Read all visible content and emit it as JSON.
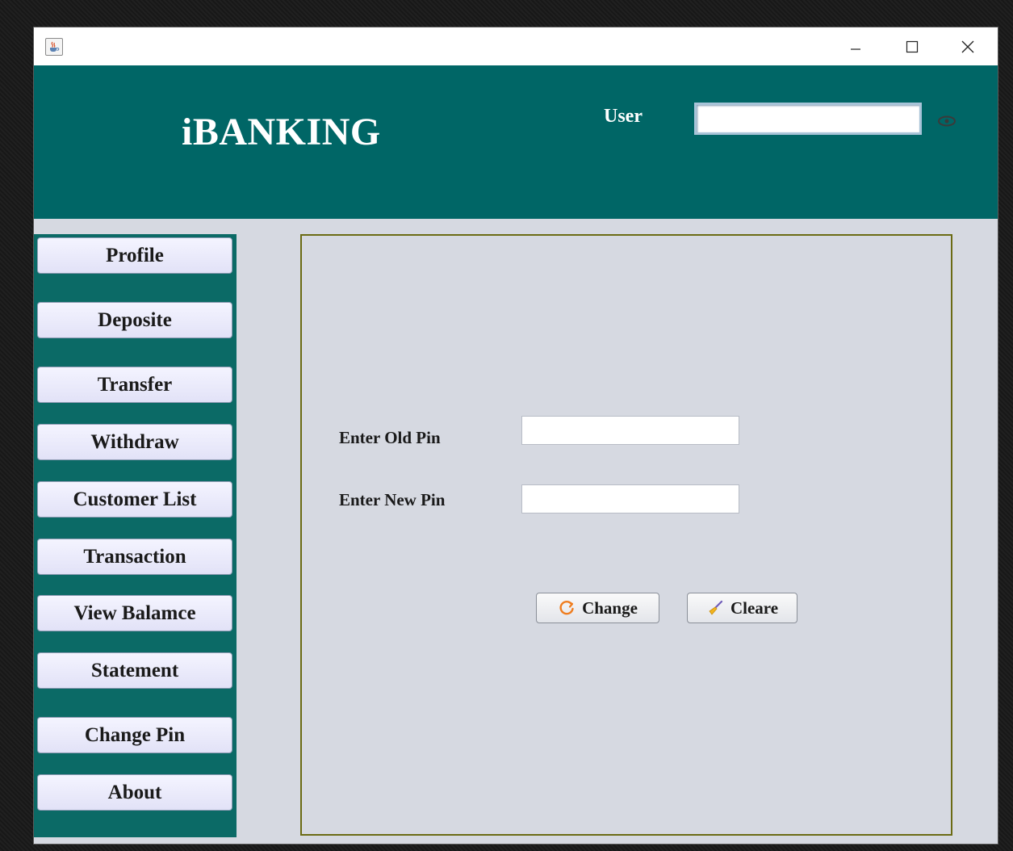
{
  "header": {
    "brand": "iBANKING",
    "user_label": "User",
    "user_value": ""
  },
  "icons": {
    "app": "java-coffee-icon",
    "show_password": "eye-icon",
    "change": "refresh-icon",
    "clear": "broom-icon"
  },
  "sidebar": {
    "items": [
      {
        "label": "Profile"
      },
      {
        "label": "Deposite"
      },
      {
        "label": "Transfer"
      },
      {
        "label": "Withdraw"
      },
      {
        "label": "Customer List"
      },
      {
        "label": "Transaction"
      },
      {
        "label": "View Balamce"
      },
      {
        "label": "Statement"
      },
      {
        "label": "Change Pin"
      },
      {
        "label": "About"
      }
    ]
  },
  "form": {
    "old_pin_label": "Enter Old Pin",
    "old_pin_value": "",
    "new_pin_label": "Enter New Pin",
    "new_pin_value": "",
    "change_label": "Change",
    "clear_label": "Cleare"
  },
  "colors": {
    "header_bg": "#006666",
    "sidebar_bg": "#0b6a66",
    "content_bg": "#d6d9e1",
    "content_border": "#6b6b14"
  }
}
